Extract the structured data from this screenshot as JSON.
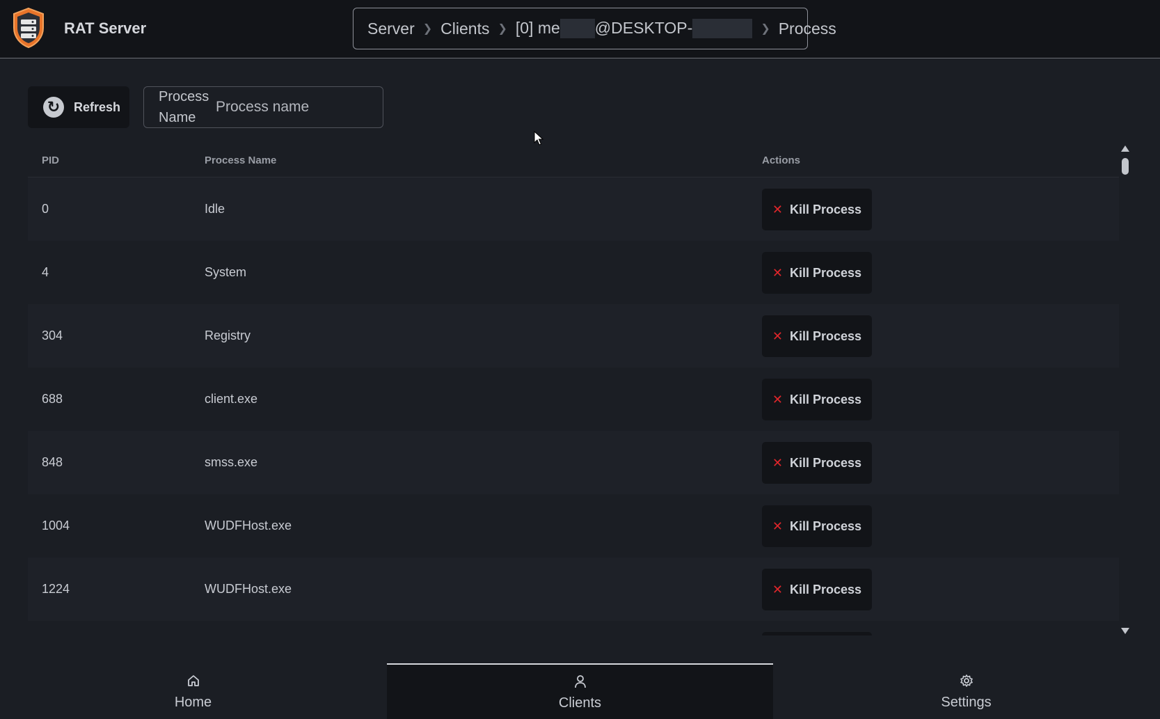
{
  "app": {
    "title": "RAT Server",
    "logo_icon": "server-shield-icon"
  },
  "breadcrumb": {
    "items": [
      "Server",
      "Clients",
      "[0] me",
      "@DESKTOP-",
      "Process"
    ]
  },
  "toolbar": {
    "refresh_label": "Refresh",
    "refresh_icon": "refresh-icon",
    "search_label": "Process Name",
    "search_placeholder": "Process name",
    "search_value": ""
  },
  "table": {
    "columns": [
      "PID",
      "Process Name",
      "Actions"
    ],
    "rows": [
      {
        "pid": "0",
        "name": "Idle",
        "action": "Kill Process"
      },
      {
        "pid": "4",
        "name": "System",
        "action": "Kill Process"
      },
      {
        "pid": "304",
        "name": "Registry",
        "action": "Kill Process"
      },
      {
        "pid": "688",
        "name": "client.exe",
        "action": "Kill Process"
      },
      {
        "pid": "848",
        "name": "smss.exe",
        "action": "Kill Process"
      },
      {
        "pid": "1004",
        "name": "WUDFHost.exe",
        "action": "Kill Process"
      },
      {
        "pid": "1224",
        "name": "WUDFHost.exe",
        "action": "Kill Process"
      }
    ]
  },
  "nav": {
    "items": [
      {
        "label": "Home",
        "icon": "home-icon",
        "active": false
      },
      {
        "label": "Clients",
        "icon": "user-icon",
        "active": true
      },
      {
        "label": "Settings",
        "icon": "gear-icon",
        "active": false
      }
    ]
  },
  "colors": {
    "background": "#1b1e24",
    "header": "#121418",
    "kill_accent": "#e0262b",
    "logo_orange": "#e8742a"
  }
}
